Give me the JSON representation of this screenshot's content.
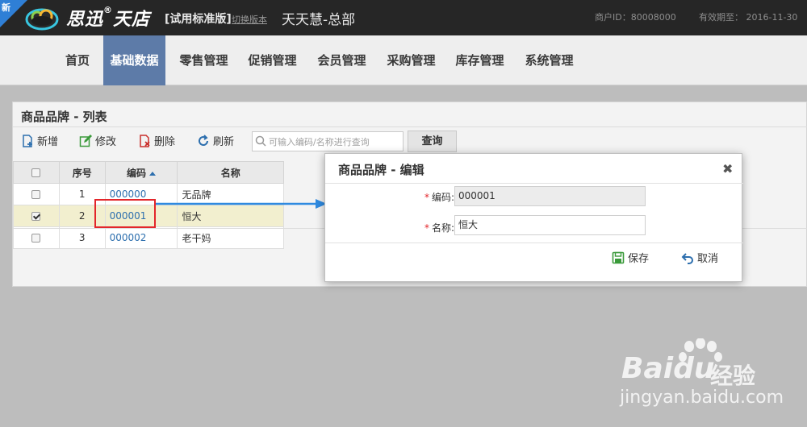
{
  "header": {
    "badge": "新",
    "brand": "思迅",
    "brand_mark": "®",
    "brand_product": "天店",
    "edition": "[试用标准版]",
    "switch_link": "切换版本",
    "store_name": "天天慧-总部",
    "merchant_id": "商户ID：80008000",
    "expiry": "有效期至：  2016-11-30"
  },
  "nav": {
    "items": [
      {
        "label": "首页"
      },
      {
        "label": "基础数据",
        "active": true
      },
      {
        "label": "零售管理"
      },
      {
        "label": "促销管理"
      },
      {
        "label": "会员管理"
      },
      {
        "label": "采购管理"
      },
      {
        "label": "库存管理"
      },
      {
        "label": "系统管理"
      }
    ]
  },
  "panel": {
    "title": "商品品牌 - 列表",
    "toolbar": {
      "add": "新增",
      "edit": "修改",
      "delete": "删除",
      "refresh": "刷新",
      "search_placeholder": "可输入编码/名称进行查询",
      "query": "查询"
    },
    "table": {
      "headers": {
        "seq": "序号",
        "code": "编码",
        "name": "名称"
      },
      "rows": [
        {
          "seq": "1",
          "code": "000000",
          "name": "无品牌",
          "checked": false
        },
        {
          "seq": "2",
          "code": "000001",
          "name": "恒大",
          "checked": true
        },
        {
          "seq": "3",
          "code": "000002",
          "name": "老干妈",
          "checked": false
        }
      ]
    }
  },
  "dialog": {
    "title": "商品品牌  -  编辑",
    "close": "✖",
    "code_label": "编码:",
    "code_value": "000001",
    "name_label": "名称:",
    "name_value": "恒大",
    "required_mark": "*",
    "save": "保存",
    "cancel": "取消"
  },
  "watermark": {
    "brand": "Bai",
    "brand_tail": "du",
    "cn": "经验",
    "url": "jingyan.baidu.com"
  },
  "colors": {
    "accent_nav": "#5d7ba8",
    "highlight_box": "#e3262b",
    "arrow": "#2f8ae0",
    "link": "#2d6fae"
  }
}
